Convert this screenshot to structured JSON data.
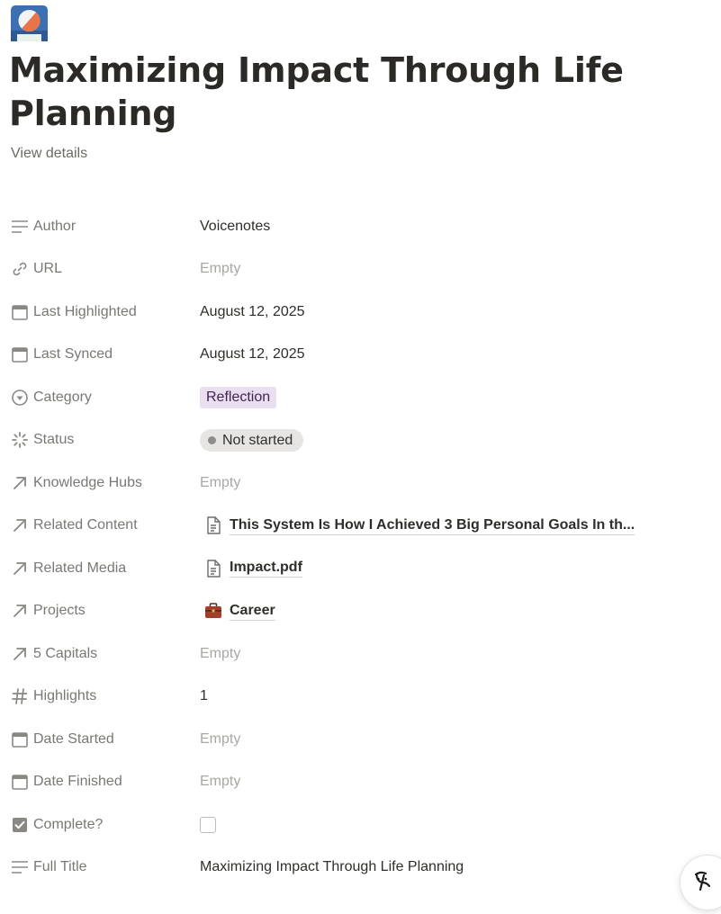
{
  "page": {
    "title": "Maximizing Impact Through Life Planning",
    "view_details": "View details"
  },
  "properties": [
    {
      "label": "Author",
      "value": "Voicenotes",
      "icon": "text-lines-icon"
    },
    {
      "label": "URL",
      "value": "Empty",
      "icon": "link-icon"
    },
    {
      "label": "Last Highlighted",
      "value": "August 12, 2025",
      "icon": "calendar-icon"
    },
    {
      "label": "Last Synced",
      "value": "August 12, 2025",
      "icon": "calendar-icon"
    },
    {
      "label": "Category",
      "value": "Reflection",
      "icon": "select-circle-icon"
    },
    {
      "label": "Status",
      "value": "Not started",
      "icon": "status-spinner-icon"
    },
    {
      "label": "Knowledge Hubs",
      "value": "Empty",
      "icon": "relation-arrow-icon"
    },
    {
      "label": "Related Content",
      "value": "This System Is How I Achieved 3 Big Personal Goals In th...",
      "icon": "relation-arrow-icon"
    },
    {
      "label": "Related Media",
      "value": "Impact.pdf",
      "icon": "relation-arrow-icon"
    },
    {
      "label": "Projects",
      "value": "Career",
      "icon": "relation-arrow-icon"
    },
    {
      "label": "5 Capitals",
      "value": "Empty",
      "icon": "relation-arrow-icon"
    },
    {
      "label": "Highlights",
      "value": "1",
      "icon": "hash-icon"
    },
    {
      "label": "Date Started",
      "value": "Empty",
      "icon": "calendar-icon"
    },
    {
      "label": "Date Finished",
      "value": "Empty",
      "icon": "calendar-icon"
    },
    {
      "label": "Complete?",
      "value": "",
      "icon": "checkbox-checked-icon"
    },
    {
      "label": "Full Title",
      "value": "Maximizing Impact Through Life Planning",
      "icon": "text-lines-icon"
    }
  ],
  "colors": {
    "tag_bg": "#eadff0",
    "tag_text": "#412454",
    "status_bg": "#e6e5e3",
    "label_text": "#7a7874",
    "empty_text": "#a9a7a3"
  }
}
